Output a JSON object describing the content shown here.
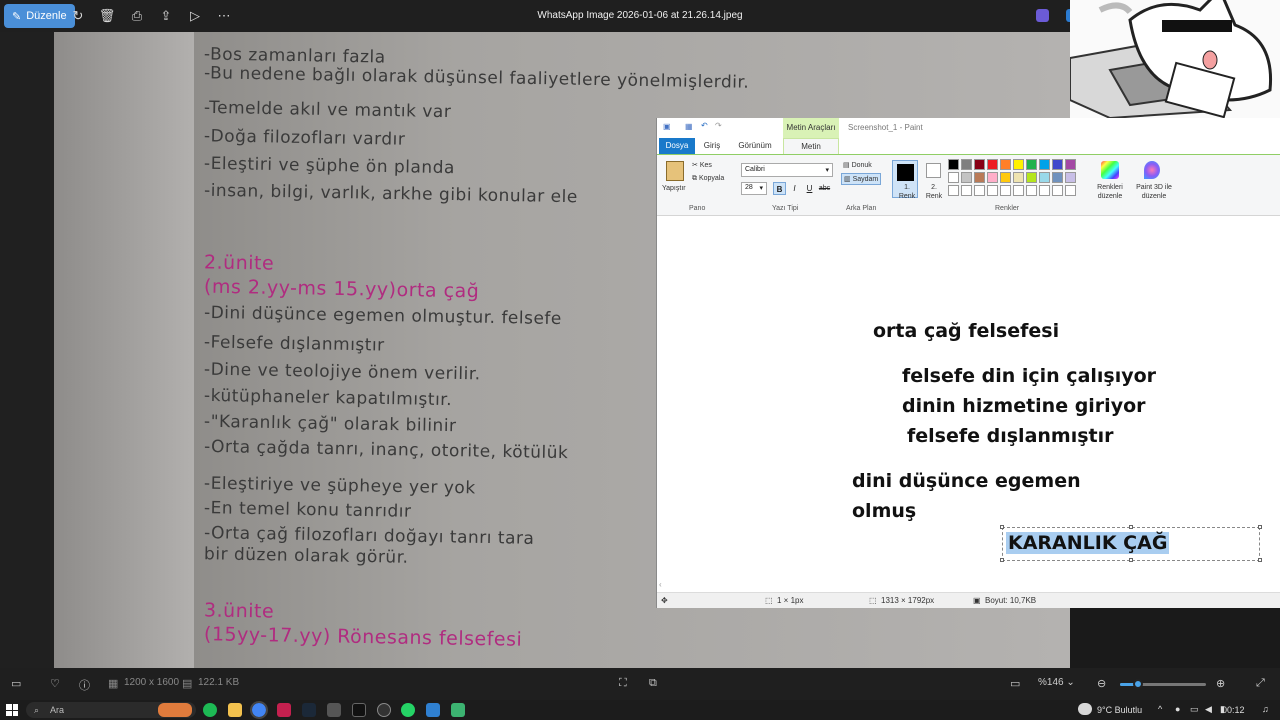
{
  "photos_app": {
    "edit_label": "Düzenle",
    "file_title": "WhatsApp Image 2026-01-06 at 21.26.14.jpeg",
    "image_dimensions": "1200 x 1600",
    "file_size": "122.1 KB",
    "zoom": "%146"
  },
  "photo_notes": {
    "lines": [
      "-Bos zamanları fazla",
      "-Bu nedene bağlı olarak düşünsel faaliyetlere yönelmişlerdir.",
      "-Temelde akıl ve mantık var",
      "-Doğa filozofları vardır",
      "-Eleştiri ve şüphe ön planda",
      "-insan, bilgi, varlık, arkhe gibi konular ele",
      "-Dini düşünce egemen olmuştur. felsefe",
      "-Felsefe dışlanmıştır",
      "-Dine ve teolojiye önem verilir.",
      "-kütüphaneler kapatılmıştır.",
      "-\"Karanlık çağ\" olarak bilinir",
      "-Orta çağda tanrı, inanç, otorite, kötülük",
      "-Eleştiriye ve şüpheye yer yok",
      "-En temel konu tanrıdır",
      "-Orta çağ filozofları doğayı tanrı tara",
      "bir düzen olarak görür."
    ],
    "headings": [
      "2.ünite",
      "(ms 2.yy-ms 15.yy)orta çağ",
      "3.ünite",
      "(15yy-17.yy) Rönesans felsefesi"
    ]
  },
  "paint": {
    "context_tab": "Metin Araçları",
    "title": "Screenshot_1 - Paint",
    "tabs": [
      "Dosya",
      "Giriş",
      "Görünüm",
      "Metin"
    ],
    "clipboard": {
      "paste": "Yapıştır",
      "cut": "Kes",
      "copy": "Kopyala",
      "group": "Pano"
    },
    "font": {
      "family": "Calibri",
      "size": "28",
      "group": "Yazı Tipi"
    },
    "background": {
      "opaque": "Donuk",
      "transparent": "Saydam",
      "group": "Arka Plan"
    },
    "colors": {
      "color1": "1. Renk",
      "color2": "2. Renk",
      "edit": "Renkleri düzenle",
      "paint3d": "Paint 3D ile düzenle",
      "group": "Renkler"
    },
    "canvas_text": {
      "title": "orta çağ felsefesi",
      "line1": "felsefe din için çalışıyor",
      "line2": "dinin hizmetine giriyor",
      "line3": "felsefe dışlanmıştır",
      "line4": "dini düşünce egemen",
      "line5": "olmuş",
      "selected": "KARANLIK ÇAĞ"
    },
    "status": {
      "selection": "1 × 1px",
      "dimensions": "1313 × 1792px",
      "size": "Boyut: 10,7KB"
    }
  },
  "taskbar": {
    "search": "Ara",
    "weather": "9°C Bulutlu",
    "time": "00:12"
  },
  "colors": {
    "palette": [
      "#000000",
      "#7f7f7f",
      "#880015",
      "#ed1c24",
      "#ff7f27",
      "#fff200",
      "#22b14c",
      "#00a2e8",
      "#3f48cc",
      "#a349a4",
      "#ffffff",
      "#c3c3c3",
      "#b97a57",
      "#ffaec9",
      "#ffc90e",
      "#efe4b0",
      "#b5e61d",
      "#99d9ea",
      "#7092be",
      "#c8bfe7"
    ]
  }
}
